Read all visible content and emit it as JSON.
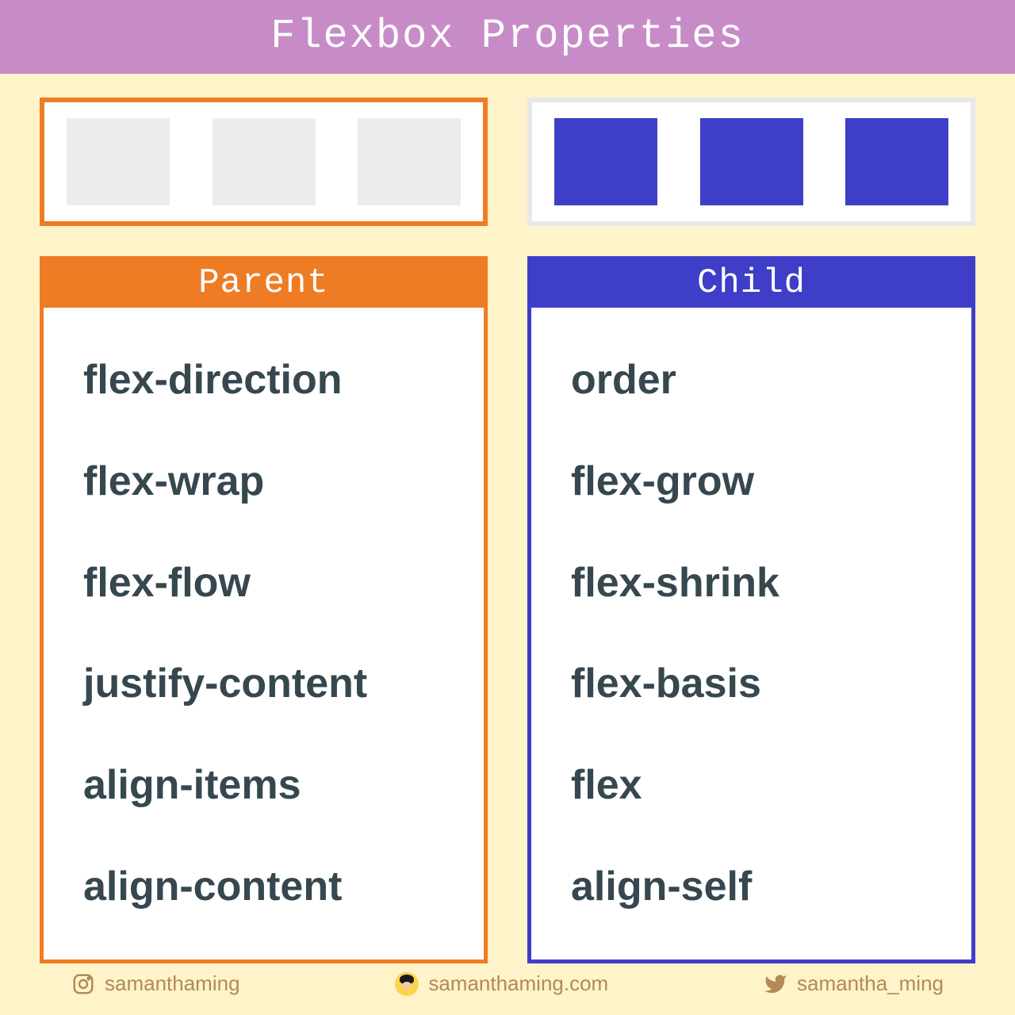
{
  "header": {
    "title": "Flexbox Properties"
  },
  "columns": {
    "parent": {
      "heading": "Parent",
      "properties": [
        "flex-direction",
        "flex-wrap",
        "flex-flow",
        "justify-content",
        "align-items",
        "align-content"
      ]
    },
    "child": {
      "heading": "Child",
      "properties": [
        "order",
        "flex-grow",
        "flex-shrink",
        "flex-basis",
        "flex",
        "align-self"
      ]
    }
  },
  "footer": {
    "instagram": "samanthaming",
    "website": "samanthaming.com",
    "twitter": "samantha_ming"
  },
  "colors": {
    "accent_orange": "#ee7c24",
    "accent_blue": "#3e3ec9",
    "header_bg": "#c78cc7",
    "page_bg": "#fff3c9",
    "footer_text": "#b18a57"
  }
}
